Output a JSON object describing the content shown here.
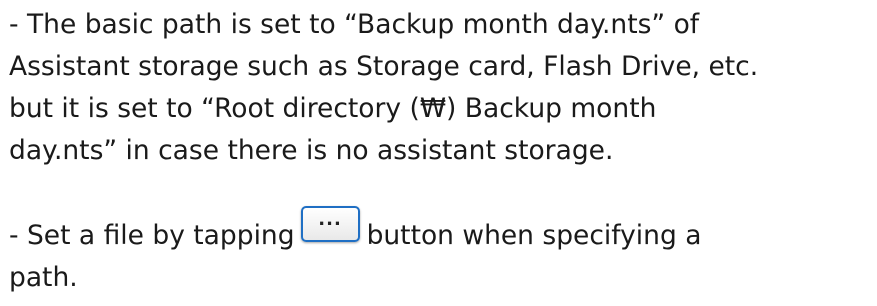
{
  "paragraphs": {
    "p1": {
      "lines": [
        "- The basic path is set to “Backup month day.nts” of",
        "Assistant storage such as Storage card, Flash Drive, etc.",
        "but it is set to “Root directory (₩) Backup month",
        "day.nts” in case there is no assistant storage."
      ]
    },
    "p2": {
      "before_button": "- Set a file by tapping",
      "button_label": "...",
      "after_button": "button when specifying a",
      "line2": "path."
    }
  },
  "colors": {
    "text": "#1a1a1a",
    "button_border": "#1f6fc4"
  },
  "icons": {
    "browse_button": "ellipsis-button"
  }
}
